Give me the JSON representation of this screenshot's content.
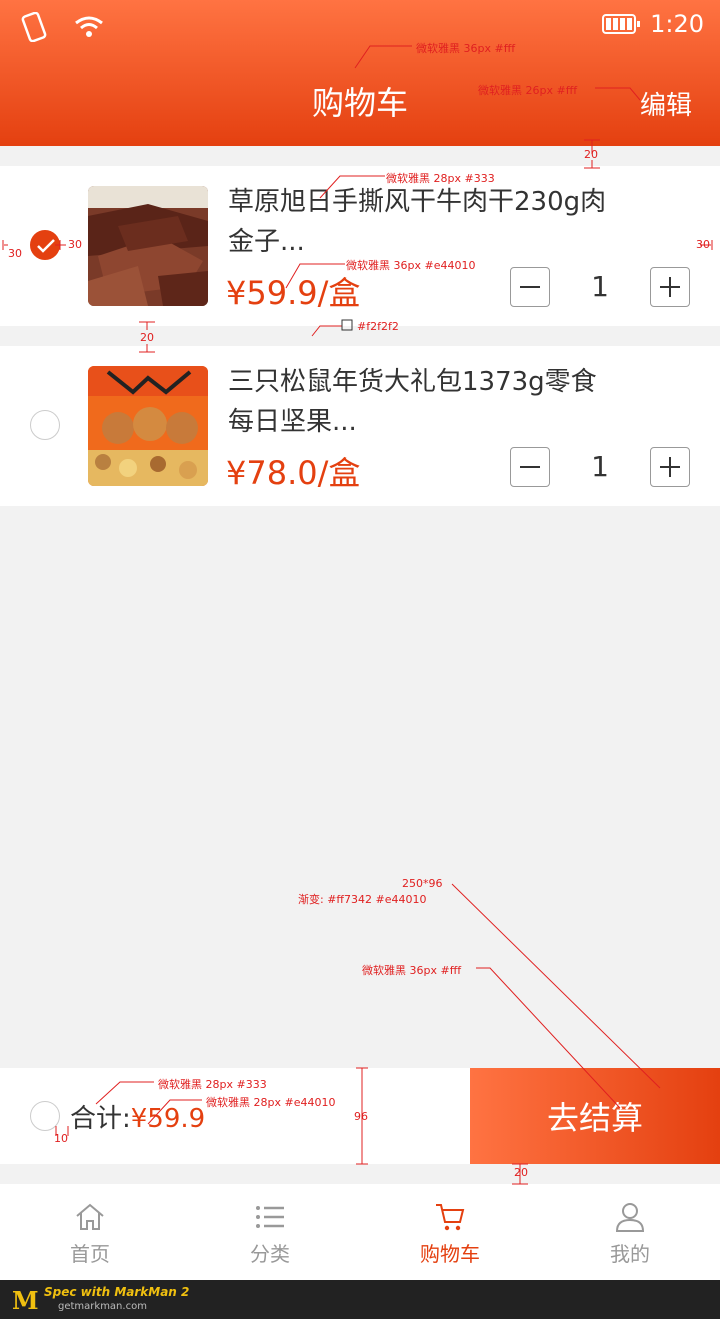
{
  "status": {
    "time": "1:20"
  },
  "header": {
    "title": "购物车",
    "edit_label": "编辑"
  },
  "items": [
    {
      "name": "草原旭日手撕风干牛肉干230g肉金子...",
      "price": "¥59.9/盒",
      "qty": "1",
      "checked": true
    },
    {
      "name": "三只松鼠年货大礼包1373g零食每日坚果...",
      "price": "¥78.0/盒",
      "qty": "1",
      "checked": false
    }
  ],
  "summary": {
    "total_label": "合计:",
    "total_value": "¥59.9",
    "checkout_label": "去结算"
  },
  "tabs": [
    {
      "label": "首页",
      "icon": "home-icon"
    },
    {
      "label": "分类",
      "icon": "list-icon"
    },
    {
      "label": "购物车",
      "icon": "cart-icon",
      "active": true
    },
    {
      "label": "我的",
      "icon": "user-icon"
    }
  ],
  "colors": {
    "accent": "#e44010",
    "accent_light": "#ff7342",
    "background": "#f2f2f2",
    "text": "#333333"
  },
  "annotations": {
    "title_spec": "微软雅黑 36px #fff",
    "edit_spec": "微软雅黑 26px #fff",
    "gap_top": "20",
    "name_spec": "微软雅黑 28px #333",
    "margin_left": "30",
    "margin_right": "30",
    "check_gap": "30",
    "price_spec": "微软雅黑 36px #e44010",
    "gap_between": "20",
    "bg_spec": "#f2f2f2",
    "btn_size": "250*96",
    "btn_gradient": "渐变: #ff7342 #e44010",
    "btn_text_spec": "微软雅黑 36px #fff",
    "total_spec": "微软雅黑 28px #333",
    "total_price_spec": "微软雅黑 28px #e44010",
    "bar_height": "96",
    "check_text_gap": "10",
    "tab_gap": "20"
  },
  "footer": {
    "brand": "Spec with",
    "product": "MarkMan 2",
    "site": "getmarkman.com"
  }
}
